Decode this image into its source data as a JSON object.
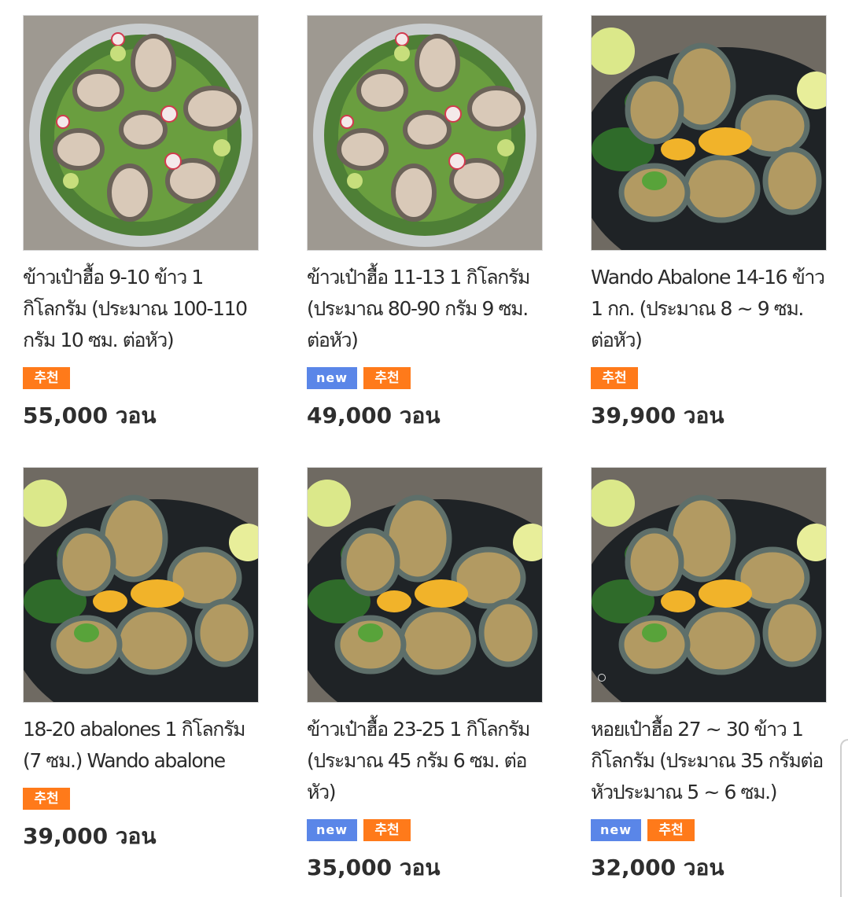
{
  "products": [
    {
      "title": "ข้าวเป๋าฮื้อ 9-10 ข้าว 1 กิโลกรัม (ประมาณ 100-110 กรัม 10 ซม. ต่อหัว)",
      "badges": [
        "추천"
      ],
      "price": "55,000 วอน",
      "image": "raw-abalone-platter-image"
    },
    {
      "title": "ข้าวเป๋าฮื้อ 11-13 1 กิโลกรัม (ประมาณ 80-90 กรัม 9 ซม. ต่อหัว)",
      "badges": [
        "new",
        "추천"
      ],
      "price": "49,000 วอน",
      "image": "raw-abalone-platter-image"
    },
    {
      "title": "Wando Abalone 14-16 ข้าว 1 กก. (ประมาณ 8 ~ 9 ซม. ต่อหัว)",
      "badges": [
        "추천"
      ],
      "price": "39,900 วอน",
      "image": "grilled-abalone-image"
    },
    {
      "title": "18-20 abalones 1 กิโลกรัม (7 ซม.) Wando abalone",
      "badges": [
        "추천"
      ],
      "price": "39,000 วอน",
      "image": "grilled-abalone-image"
    },
    {
      "title": "ข้าวเป๋าฮื้อ 23-25 1 กิโลกรัม (ประมาณ 45 กรัม 6 ซม. ต่อหัว)",
      "badges": [
        "new",
        "추천"
      ],
      "price": "35,000 วอน",
      "image": "grilled-abalone-image"
    },
    {
      "title": "หอยเป๋าฮื้อ 27 ~ 30 ข้าว 1 กิโลกรัม (ประมาณ 35 กรัมต่อหัวประมาณ 5 ~ 6 ซม.)",
      "badges": [
        "new",
        "추천"
      ],
      "price": "32,000 วอน",
      "image": "grilled-abalone-image"
    }
  ],
  "colors": {
    "badge_new": "#5a86e8",
    "badge_recommend": "#ff7a1a",
    "text": "#2b2b2b"
  }
}
